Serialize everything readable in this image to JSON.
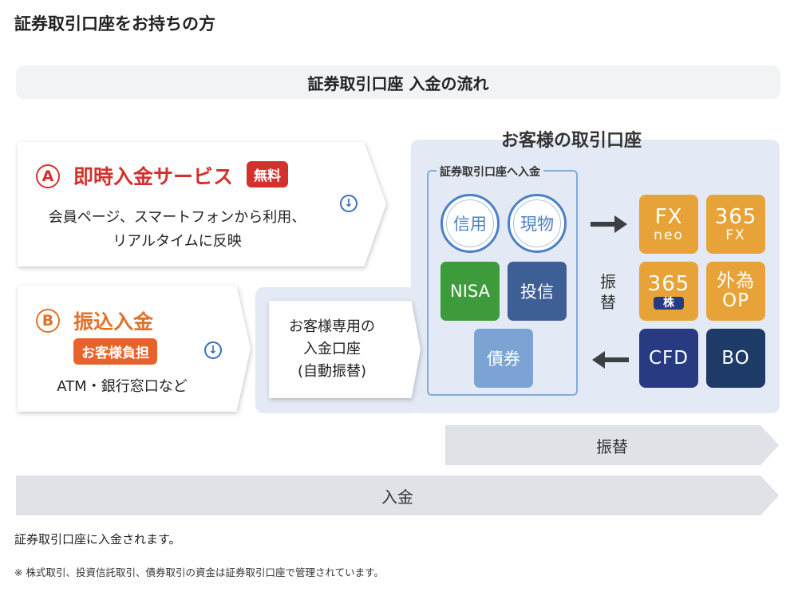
{
  "heading": "証券取引口座をお持ちの方",
  "flow_title": "証券取引口座 入金の流れ",
  "account_title": "お客様の取引口座",
  "card_a": {
    "letter": "A",
    "title": "即時入金サービス",
    "badge": "無料",
    "desc_line1": "会員ページ、スマートフォンから利用、",
    "desc_line2": "リアルタイムに反映"
  },
  "card_b": {
    "letter": "B",
    "title": "振込入金",
    "badge": "お客様負担",
    "desc": "ATM・銀行窓口など"
  },
  "dedicated": {
    "line1": "お客様専用の",
    "line2": "入金口座",
    "line3": "(自動振替)"
  },
  "securities": {
    "title": "証券取引口座へ入金",
    "shinyo": "信用",
    "genbutsu": "現物",
    "nisa": "NISA",
    "toshin": "投信",
    "saiken": "債券"
  },
  "furikae_vertical": [
    "振",
    "替"
  ],
  "products": {
    "fx_neo": {
      "main": "FX",
      "sub": "neo"
    },
    "fx365": {
      "main": "365",
      "sub": "FX"
    },
    "kabu365": {
      "main": "365",
      "sub": "株"
    },
    "gaitame_op": {
      "main": "外為",
      "sub": "OP"
    },
    "cfd": "CFD",
    "bo": "BO"
  },
  "bars": {
    "furikae": "振替",
    "nyukin": "入金"
  },
  "footer": {
    "line1": "証券取引口座に入金されます。",
    "line2": "※ 株式取引、投資信託取引、債券取引の資金は証券取引口座で管理されています。"
  },
  "colors": {
    "red": "#d2322d",
    "orange_text": "#e0722a",
    "panel": "#e3eaf5",
    "nisa_green": "#3e9b3c",
    "toshin_navy": "#3e5f95",
    "saiken_blue": "#7ba4d5",
    "product_orange": "#e7a337",
    "product_navy": "#283a82"
  },
  "icons": [
    "down-arrow-circle-icon",
    "arrow-right-icon",
    "arrow-left-icon"
  ]
}
